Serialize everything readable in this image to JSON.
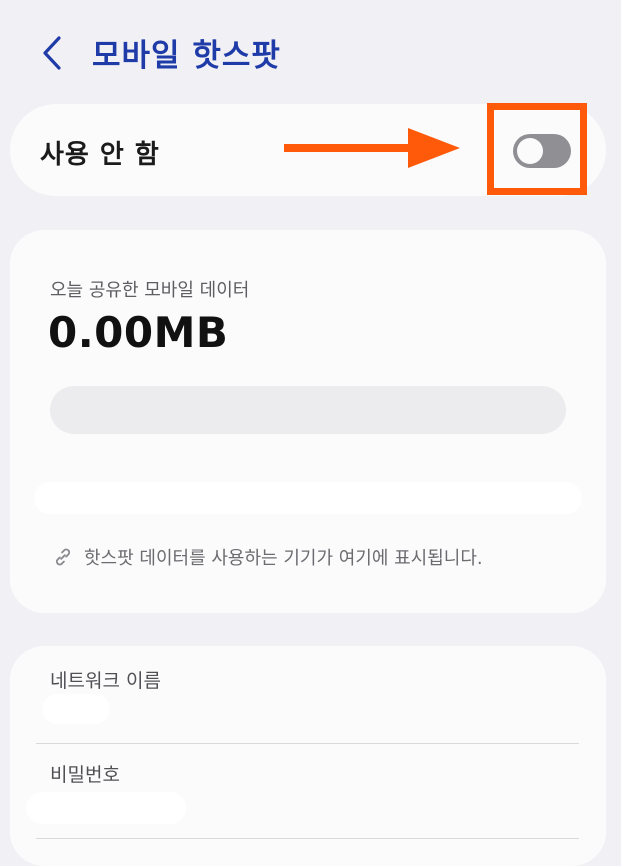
{
  "header": {
    "title": "모바일 핫스팟",
    "back_icon": "chevron-left-icon",
    "title_color": "#1e3ba8"
  },
  "hotspot_switch": {
    "label": "사용 안 함",
    "on": false,
    "track_color": "#8f8f94"
  },
  "annotation": {
    "arrow_color": "#ff5a0a",
    "highlight_color": "#ff5a0a"
  },
  "data_usage": {
    "title": "오늘 공유한 모바일 데이터",
    "value": "0.00MB",
    "progress": 0,
    "info_icon": "link-icon",
    "info_text": "핫스팟 데이터를 사용하는 기기가 여기에 표시됩니다."
  },
  "network": {
    "name_label": "네트워크 이름",
    "password_label": "비밀번호"
  }
}
